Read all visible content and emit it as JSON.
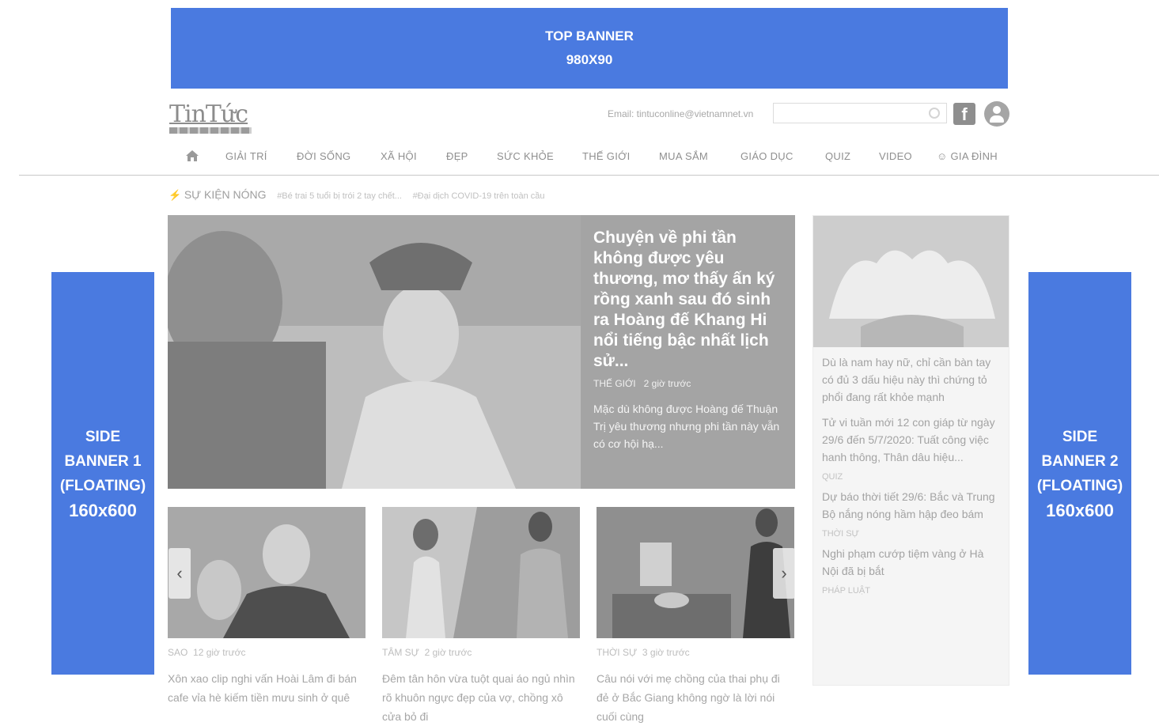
{
  "banners": {
    "top_line1": "TOP BANNER",
    "top_line2": "980X90",
    "side1": [
      "SIDE",
      "BANNER 1",
      "(FLOATING)",
      "160x600"
    ],
    "side2": [
      "SIDE",
      "BANNER 2",
      "(FLOATING)",
      "160x600"
    ]
  },
  "header": {
    "logo": "TinTức",
    "email": "Email: tintuconline@vietnamnet.vn",
    "search_placeholder": ""
  },
  "nav": {
    "items": [
      "GIẢI TRÍ",
      "ĐỜI SỐNG",
      "XÃ HỘI",
      "ĐẸP",
      "SỨC KHỎE",
      "THẾ GIỚI",
      "MUA SẮM",
      "GIÁO DỤC",
      "QUIZ",
      "VIDEO",
      "GIA ĐÌNH"
    ]
  },
  "hot": {
    "label": "SỰ KIỆN NÓNG",
    "tags": [
      "#Bé trai 5 tuổi bị trói 2 tay chết...",
      "#Đại dịch COVID-19 trên toàn cầu"
    ]
  },
  "hero": {
    "title": "Chuyện về phi tần không được yêu thương, mơ thấy ấn ký rồng xanh sau đó sinh ra Hoàng đế Khang Hi nổi tiếng bậc nhất lịch sử...",
    "category": "THẾ GIỚI",
    "time": "2 giờ trước",
    "summary": "Mặc dù không được Hoàng đế Thuận Trị yêu thương nhưng phi tần này vẫn có cơ hội hạ..."
  },
  "cards": [
    {
      "category": "SAO",
      "time": "12 giờ trước",
      "title": "Xôn xao clip nghi vấn Hoài Lâm đi bán cafe vỉa hè kiếm tiền mưu sinh ở quê"
    },
    {
      "category": "TÂM SỰ",
      "time": "2 giờ trước",
      "title": "Đêm tân hôn vừa tuột quai áo ngủ nhìn rõ khuôn ngực đẹp của vợ, chồng xô cửa bỏ đi"
    },
    {
      "category": "THỜI SỰ",
      "time": "3 giờ trước",
      "title": "Câu nói với mẹ chồng của thai phụ đi đẻ ở Bắc Giang không ngờ là lời nói cuối cùng"
    }
  ],
  "arrows": {
    "left": "‹",
    "right": "›"
  },
  "sidebar": {
    "lead": "Dù là nam hay nữ, chỉ cần bàn tay có đủ 3 dấu hiệu này thì chứng tỏ phổi đang rất khỏe mạnh",
    "items": [
      {
        "title": "Tử vi tuần mới 12 con giáp từ ngày 29/6 đến 5/7/2020: Tuất công việc hanh thông, Thân dâu hiệu...",
        "category": "QUIZ"
      },
      {
        "title": "Dự báo thời tiết 29/6: Bắc và Trung Bộ nắng nóng hầm hập đeo bám",
        "category": "THỜI SỰ"
      },
      {
        "title": "Nghi phạm cướp tiệm vàng ở Hà Nội đã bị bắt",
        "category": "PHÁP LUẬT"
      }
    ]
  },
  "colors": {
    "banner": "#4a7ae0"
  }
}
